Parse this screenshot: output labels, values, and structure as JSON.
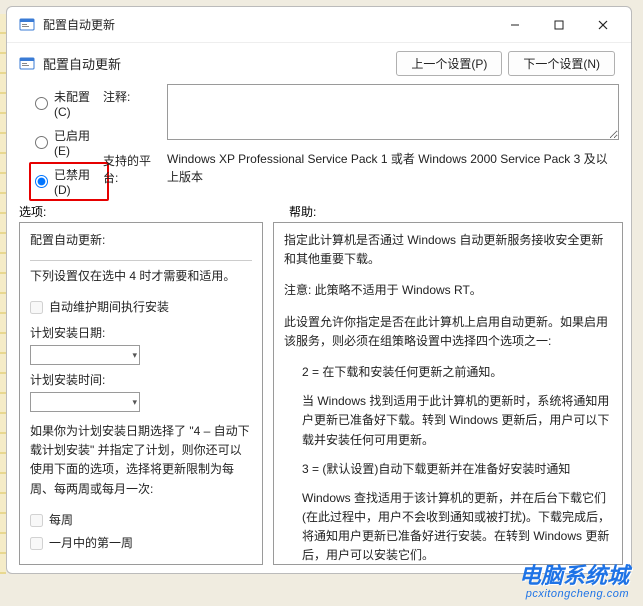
{
  "window": {
    "title": "配置自动更新",
    "subtitle": "配置自动更新"
  },
  "nav": {
    "prev": "上一个设置(P)",
    "next": "下一个设置(N)"
  },
  "radios": {
    "not_configured": "未配置(C)",
    "enabled": "已启用(E)",
    "disabled": "已禁用(D)"
  },
  "labels": {
    "comment": "注释:",
    "platform": "支持的平台:",
    "options": "选项:",
    "help": "帮助:"
  },
  "platform_text": "Windows XP Professional Service Pack 1 或者 Windows 2000 Service Pack 3 及以上版本",
  "options_panel": {
    "header": "配置自动更新:",
    "note": "下列设置仅在选中 4 时才需要和适用。",
    "chk_maint": "自动维护期间执行安装",
    "lbl_date": "计划安装日期:",
    "lbl_time": "计划安装时间:",
    "note2": "如果你为计划安装日期选择了 \"4 – 自动下载计划安装\" 并指定了计划，则你还可以使用下面的选项，选择将更新限制为每周、每两周或每月一次:",
    "chk_weekly": "每周",
    "chk_first": "一月中的第一周"
  },
  "help_panel": {
    "p1": "指定此计算机是否通过 Windows 自动更新服务接收安全更新和其他重要下载。",
    "p2": "注意: 此策略不适用于 Windows RT。",
    "p3": "此设置允许你指定是否在此计算机上启用自动更新。如果启用该服务，则必须在组策略设置中选择四个选项之一:",
    "opt2": "2 = 在下载和安装任何更新之前通知。",
    "opt2b": "当 Windows 找到适用于此计算机的更新时，系统将通知用户更新已准备好下载。转到 Windows 更新后，用户可以下载并安装任何可用更新。",
    "opt3": "3 = (默认设置)自动下载更新并在准备好安装时通知",
    "opt3b": "Windows 查找适用于该计算机的更新，并在后台下载它们(在此过程中，用户不会收到通知或被打扰)。下载完成后，将通知用户更新已准备好进行安装。在转到 Windows 更新后，用户可以安装它们。"
  },
  "watermark": {
    "line1": "电脑系统城",
    "line2": "pcxitongcheng.com"
  }
}
